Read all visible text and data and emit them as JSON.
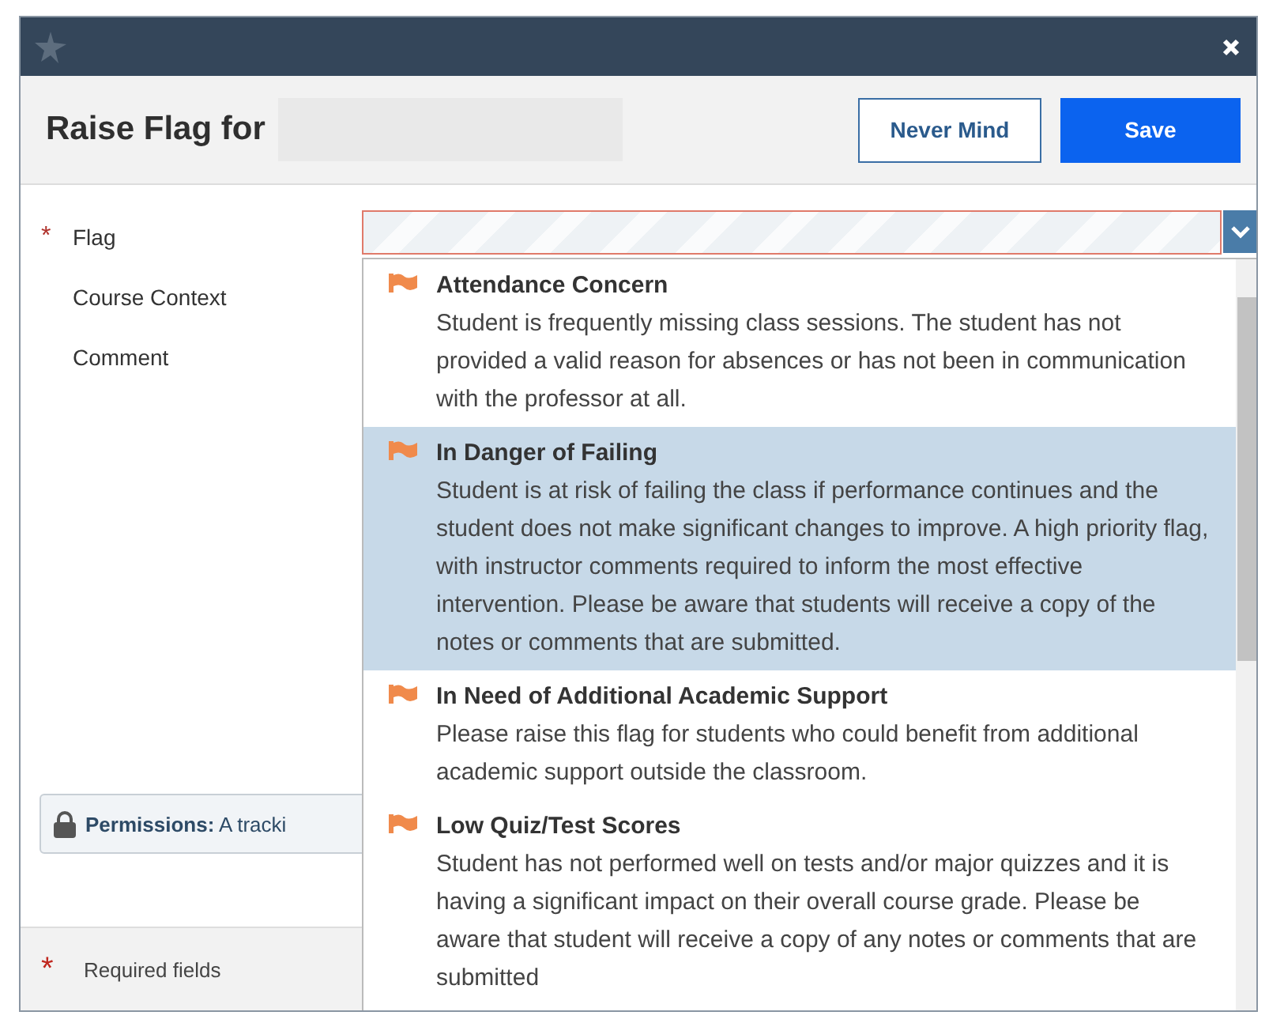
{
  "dialog": {
    "title": "Raise Flag for",
    "buttons": [
      {
        "label": "Never Mind",
        "kind": "secondary"
      },
      {
        "label": "Save",
        "kind": "primary"
      }
    ]
  },
  "required_marker": "*",
  "fields": [
    {
      "label": "Flag",
      "required": true
    },
    {
      "label": "Course Context",
      "required": false
    },
    {
      "label": "Comment",
      "required": false
    }
  ],
  "flag_options": [
    {
      "title": "Attendance Concern",
      "description": "Student is frequently missing class sessions. The student has not provided a valid reason for absences or has not been in communication with the professor at all.",
      "selected": false
    },
    {
      "title": "In Danger of Failing",
      "description": "Student is at risk of failing the class if performance continues and the student does not make significant changes to improve. A high priority flag, with instructor comments required to inform the most effective intervention. Please be aware that students will receive a copy of the notes or comments that are submitted.",
      "selected": true
    },
    {
      "title": "In Need of Additional Academic Support",
      "description": "Please raise this flag for students who could benefit from additional academic support outside the classroom.",
      "selected": false
    },
    {
      "title": "Low Quiz/Test Scores",
      "description": "Student has not performed well on tests and/or major quizzes and it is having a significant impact on their overall course grade. Please be aware that student will receive a copy of any notes or comments that are submitted",
      "selected": false
    }
  ],
  "permissions_note": "**Permissions:** A tracki",
  "footer": {
    "marker": "*",
    "required_note": "Required fields"
  }
}
